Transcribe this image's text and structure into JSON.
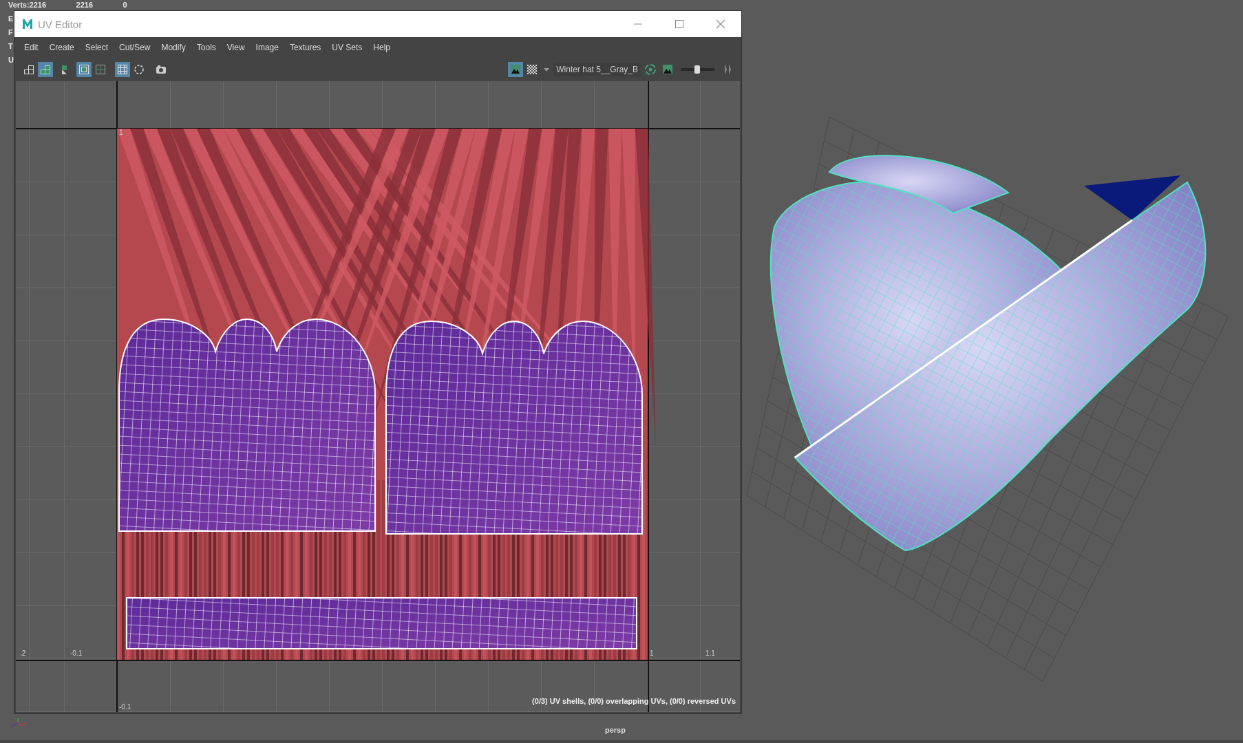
{
  "hud": {
    "rows": [
      {
        "label": "Verts:",
        "values": [
          "2216",
          "2216",
          "0"
        ]
      },
      {
        "label": "E",
        "values": []
      },
      {
        "label": "F",
        "values": []
      },
      {
        "label": "T",
        "values": []
      },
      {
        "label": "U",
        "values": []
      }
    ]
  },
  "window": {
    "title": "UV Editor",
    "menu": [
      "Edit",
      "Create",
      "Select",
      "Cut/Sew",
      "Modify",
      "Tools",
      "View",
      "Image",
      "Textures",
      "UV Sets",
      "Help"
    ],
    "toolbar_left": [
      {
        "kind": "uv-grid",
        "selected": false
      },
      {
        "kind": "uv-shell",
        "selected": true
      },
      {
        "kind": "uv-move",
        "selected": false
      },
      {
        "kind": "frame",
        "selected": true
      },
      {
        "kind": "frame-dim",
        "selected": false
      },
      {
        "kind": "grid",
        "selected": true
      },
      {
        "kind": "dashed-circle",
        "selected": false
      },
      {
        "kind": "camera",
        "selected": false
      }
    ],
    "image_toggle": {
      "selected": true
    },
    "texture_name": "Winter hat 5__Gray_B",
    "exposure": {
      "level": 0.5
    },
    "canvas": {
      "tick_labels": [
        ".2",
        "-0.1",
        "1",
        "1.1",
        "-0.1",
        "1"
      ],
      "status": "(0/3) UV shells, (0/0) overlapping UVs, (0/0) reversed UVs"
    }
  },
  "viewport": {
    "camera": "persp"
  }
}
